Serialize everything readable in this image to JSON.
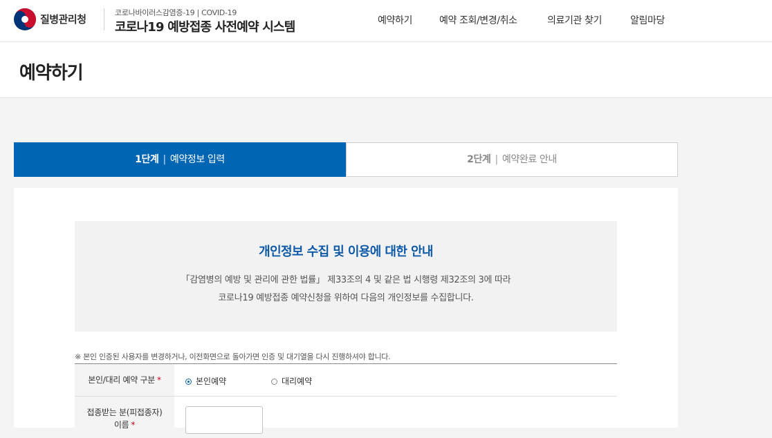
{
  "header": {
    "logo_text": "질병관리청",
    "sub_title": "코로나바이러스감염증-19 | COVID-19",
    "main_title": "코로나19 예방접종 사전예약 시스템",
    "nav": [
      {
        "label": "예약하기"
      },
      {
        "label": "예약 조회/변경/취소"
      },
      {
        "label": "의료기관 찾기"
      },
      {
        "label": "알림마당"
      }
    ],
    "colors": {
      "accent": "#0066b3",
      "emblem_red": "#c8102e",
      "emblem_blue": "#003478"
    }
  },
  "page": {
    "title": "예약하기"
  },
  "steps": [
    {
      "num": "1단계",
      "sep": "|",
      "label": "예약정보 입력",
      "active": true
    },
    {
      "num": "2단계",
      "sep": "|",
      "label": "예약완료 안내",
      "active": false
    }
  ],
  "notice": {
    "title": "개인정보 수집 및 이용에 대한 안내",
    "line1": "「감염병의 예방 및 관리에 관한 법률」 제33조의 4 및 같은 법 시행령 제32조의 3에 따라",
    "line2": "코로나19 예방접종 예약신청을 위하여 다음의 개인정보를 수집합니다."
  },
  "warning": "※ 본인 인증된 사용자를 변경하거나, 이전화면으로 돌아가면 인증 및 대기열을 다시 진행하셔야 합니다.",
  "form": {
    "type_row": {
      "label": "본인/대리 예약 구분",
      "required_mark": "*",
      "options": [
        {
          "label": "본인예약",
          "selected": true
        },
        {
          "label": "대리예약",
          "selected": false
        }
      ]
    },
    "name_row": {
      "label_line1": "접종받는 분(피접종자)",
      "label_line2": "이름",
      "required_mark": "*",
      "value": ""
    }
  }
}
